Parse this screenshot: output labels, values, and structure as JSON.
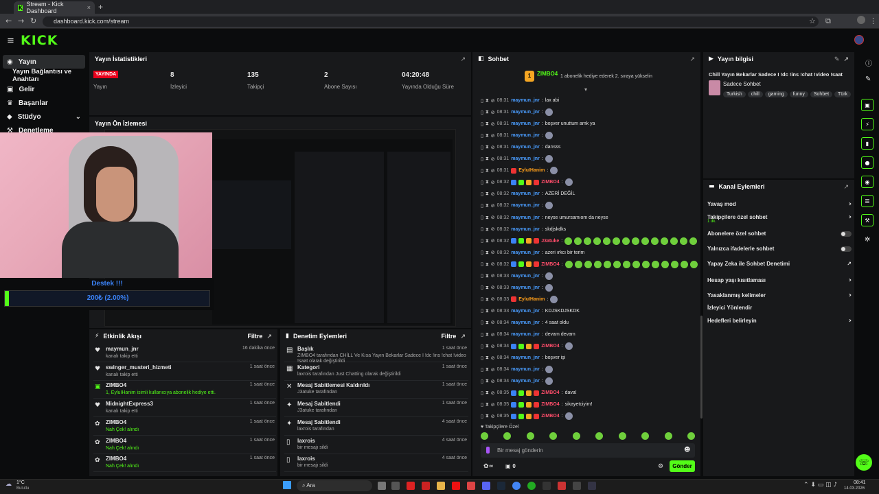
{
  "browser": {
    "tab_title": "Stream - Kick Dashboard",
    "url": "dashboard.kick.com/stream"
  },
  "header": {
    "logo": "KICK"
  },
  "sidebar": {
    "items": [
      {
        "icon": "broadcast-icon",
        "label": "Yayın"
      },
      {
        "icon": "",
        "label": "Yayın Bağlantısı ve Anahtarı"
      },
      {
        "icon": "dollar-icon",
        "label": "Gelir"
      },
      {
        "icon": "trophy-icon",
        "label": "Başarılar"
      },
      {
        "icon": "studio-icon",
        "label": "Stüdyo"
      },
      {
        "icon": "moderation-icon",
        "label": "Denetleme"
      }
    ]
  },
  "stats": {
    "title": "Yayın İstatistikleri",
    "live_badge": "YAYINDA",
    "live_label": "Yayın",
    "items": [
      {
        "value": "8",
        "label": "İzleyici"
      },
      {
        "value": "135",
        "label": "Takipçi"
      },
      {
        "value": "2",
        "label": "Abone Sayısı"
      },
      {
        "value": "04:20:48",
        "label": "Yayında Olduğu Süre"
      }
    ]
  },
  "preview": {
    "title": "Yayın Ön İzlemesi"
  },
  "overlay": {
    "donate_title": "Destek !!!",
    "donate_amount": "200₺ (2.00%)",
    "donate_progress": 0.02
  },
  "events": {
    "title": "Etkinlik Akışı",
    "filter": "Filtre",
    "rows": [
      {
        "icon": "heart-icon",
        "name": "maymun_jnr",
        "sub": "kanalı takip etti",
        "time": "16 dakika önce"
      },
      {
        "icon": "heart-icon",
        "name": "swinger_musteri_hizmeti",
        "sub": "kanalı takip etti",
        "time": "1 saat önce"
      },
      {
        "icon": "gift-icon",
        "name": "ZIMBO4",
        "sub": "1, EyluIHanim isimli kullanıcıya abonelik hediye etti.",
        "time": "1 saat önce"
      },
      {
        "icon": "heart-icon",
        "name": "MidnightExpress3",
        "sub": "kanalı takip etti",
        "time": "1 saat önce"
      },
      {
        "icon": "reward-icon",
        "name": "ZIMBO4",
        "sub": "Nah Çek! alındı",
        "time": "1 saat önce"
      },
      {
        "icon": "reward-icon",
        "name": "ZIMBO4",
        "sub": "Nah Çek! alındı",
        "time": "1 saat önce"
      },
      {
        "icon": "reward-icon",
        "name": "ZIMBO4",
        "sub": "Nah Çek! alındı",
        "time": "1 saat önce"
      }
    ]
  },
  "modlog": {
    "title": "Denetim Eylemleri",
    "filter": "Filtre",
    "rows": [
      {
        "icon": "title-icon",
        "title": "Başlık",
        "sub": "ZIMBO4 tarafından CHİLL Ve Kısa Yayın Bekarlar Sadece I !dc !ins !chat !video !saat olarak değiştirildi",
        "time": "1 saat önce"
      },
      {
        "icon": "category-icon",
        "title": "Kategori",
        "sub": "laxrois tarafından Just Chatting olarak değiştirildi",
        "time": "1 saat önce"
      },
      {
        "icon": "unpin-icon",
        "title": "Mesaj Sabitlemesi Kaldırıldı",
        "sub": "J3atuke tarafından",
        "time": "1 saat önce"
      },
      {
        "icon": "pin-icon",
        "title": "Mesaj Sabitlendi",
        "sub": "J3atuke tarafından",
        "time": "1 saat önce"
      },
      {
        "icon": "pin-icon",
        "title": "Mesaj Sabitlendi",
        "sub": "laxrois tarafından",
        "time": "4 saat önce"
      },
      {
        "icon": "trash-icon",
        "title": "laxrois",
        "sub": "bir mesajı sildi",
        "time": "4 saat önce"
      },
      {
        "icon": "trash-icon",
        "title": "laxrois",
        "sub": "bir mesajı sildi",
        "time": "4 saat önce"
      }
    ]
  },
  "chat": {
    "title": "Sohbet",
    "gifter": "ZIMBO4",
    "gift_text": "1 abonelik hediye ederek 2. sıraya yükselin",
    "followers_only": "Takipçilere Özel",
    "placeholder": "Bir mesaj gönderin",
    "send": "Gönder",
    "count": "0",
    "messages": [
      {
        "time": "08:31",
        "user": "maymun_jnr",
        "color": "#4a9dff",
        "text": "lax abi"
      },
      {
        "time": "08:31",
        "user": "maymun_jnr",
        "color": "#4a9dff",
        "text": ""
      },
      {
        "time": "08:31",
        "user": "maymun_jnr",
        "color": "#4a9dff",
        "text": "boşver unuttum amk ya"
      },
      {
        "time": "08:31",
        "user": "maymun_jnr",
        "color": "#4a9dff",
        "text": ""
      },
      {
        "time": "08:31",
        "user": "maymun_jnr",
        "color": "#4a9dff",
        "text": "darısss"
      },
      {
        "time": "08:31",
        "user": "maymun_jnr",
        "color": "#4a9dff",
        "text": ""
      },
      {
        "time": "08:31",
        "user": "EyluIHanim",
        "color": "#ff9f1a",
        "text": ""
      },
      {
        "time": "08:32",
        "user": "ZIMBO4",
        "color": "#ff4d6a",
        "text": ""
      },
      {
        "time": "08:32",
        "user": "maymun_jnr",
        "color": "#4a9dff",
        "text": "AZERİ DEĞİL"
      },
      {
        "time": "08:32",
        "user": "maymun_jnr",
        "color": "#4a9dff",
        "text": ""
      },
      {
        "time": "08:32",
        "user": "maymun_jnr",
        "color": "#4a9dff",
        "text": "neyse umursamıom da neyse"
      },
      {
        "time": "08:32",
        "user": "maymun_jnr",
        "color": "#4a9dff",
        "text": "skdjskdks"
      },
      {
        "time": "08:32",
        "user": "J3atuke",
        "color": "#ff4d6a",
        "text": ""
      },
      {
        "time": "08:32",
        "user": "maymun_jnr",
        "color": "#4a9dff",
        "text": "azeri ırkcı bir terim"
      },
      {
        "time": "08:32",
        "user": "ZIMBO4",
        "color": "#ff4d6a",
        "text": ""
      },
      {
        "time": "08:33",
        "user": "maymun_jnr",
        "color": "#4a9dff",
        "text": ""
      },
      {
        "time": "08:33",
        "user": "maymun_jnr",
        "color": "#4a9dff",
        "text": ""
      },
      {
        "time": "08:33",
        "user": "EyluIHanim",
        "color": "#ff9f1a",
        "text": ""
      },
      {
        "time": "08:33",
        "user": "maymun_jnr",
        "color": "#4a9dff",
        "text": "KDJSKDJSKDK"
      },
      {
        "time": "08:34",
        "user": "maymun_jnr",
        "color": "#4a9dff",
        "text": "4 saat oldu"
      },
      {
        "time": "08:34",
        "user": "maymun_jnr",
        "color": "#4a9dff",
        "text": "devam devam"
      },
      {
        "time": "08:34",
        "user": "ZIMBO4",
        "color": "#ff4d6a",
        "text": ""
      },
      {
        "time": "08:34",
        "user": "maymun_jnr",
        "color": "#4a9dff",
        "text": "boşver işi"
      },
      {
        "time": "08:34",
        "user": "maymun_jnr",
        "color": "#4a9dff",
        "text": ""
      },
      {
        "time": "08:34",
        "user": "maymun_jnr",
        "color": "#4a9dff",
        "text": ""
      },
      {
        "time": "08:35",
        "user": "ZIMBO4",
        "color": "#ff4d6a",
        "text": "dava!"
      },
      {
        "time": "08:35",
        "user": "ZIMBO4",
        "color": "#ff4d6a",
        "text": "sikayetciyim!"
      },
      {
        "time": "08:35",
        "user": "ZIMBO4",
        "color": "#ff4d6a",
        "text": ""
      }
    ]
  },
  "stream_info": {
    "title": "Yayın bilgisi",
    "stream_title": "Chill Yayın Bekarlar Sadece I !dc !ins !chat !video !saat",
    "category": "Sadece Sohbet",
    "tags": [
      "Turkish",
      "chill",
      "gaming",
      "funny",
      "Sohbet",
      "Türk"
    ]
  },
  "actions": {
    "title": "Kanal Eylemleri",
    "items": [
      {
        "label": "Yavaş mod",
        "type": "arrow",
        "sub": ""
      },
      {
        "label": "Takipçilere özel sohbet",
        "type": "arrow",
        "sub": "1 dk."
      },
      {
        "label": "Abonelere özel sohbet",
        "type": "toggle",
        "sub": ""
      },
      {
        "label": "Yalnızca ifadelerle sohbet",
        "type": "toggle",
        "sub": ""
      },
      {
        "label": "Yapay Zeka ile Sohbet Denetimi",
        "type": "link",
        "sub": ""
      },
      {
        "label": "Hesap yaşı kısıtlaması",
        "type": "arrow",
        "sub": ""
      },
      {
        "label": "Yasaklanmış kelimeler",
        "type": "arrow",
        "sub": ""
      },
      {
        "label": "İzleyici Yönlendir",
        "type": "none",
        "sub": ""
      },
      {
        "label": "Hedefleri belirleyin",
        "type": "arrow",
        "sub": ""
      }
    ]
  },
  "taskbar": {
    "weather_temp": "1°C",
    "weather_desc": "Bulutlu",
    "search": "Ara",
    "time": "08:41",
    "date": "14.03.2026"
  },
  "colors": {
    "accent": "#53fc18",
    "bg": "#0b0c0d",
    "panel": "#18191b"
  }
}
